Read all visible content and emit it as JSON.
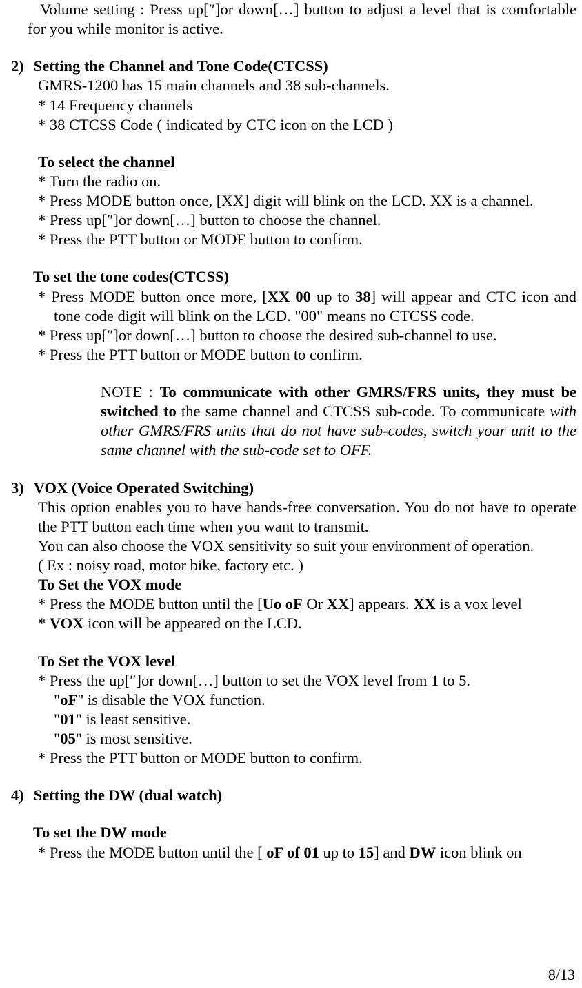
{
  "top": {
    "volume_line": "Volume setting : Press up[″]or down[…] button to adjust a level that is comfortable for you while monitor is active."
  },
  "s2": {
    "num": "2)",
    "title": "Setting the Channel and Tone Code(CTCSS)",
    "intro": "GMRS-1200 has 15 main channels and 38 sub-channels.",
    "b1": "* 14 Frequency channels",
    "b2": "* 38 CTCSS Code ( indicated by CTC icon on the LCD )",
    "sel_title": "To select the channel",
    "sel_b1": "* Turn the radio on.",
    "sel_b2": "* Press MODE button once, [XX] digit will blink on the LCD. XX is a channel.",
    "sel_b3": "* Press up[″]or down[…] button to choose the channel.",
    "sel_b4": "* Press the PTT button or MODE button to confirm.",
    "tone_title": "To set the tone codes(CTCSS)",
    "tone_b1_a": "* Press MODE button once more, [",
    "tone_b1_b": "XX 00",
    "tone_b1_c": " up to ",
    "tone_b1_d": "38",
    "tone_b1_e": "] will appear and CTC icon and tone code digit will blink on the LCD. \"00\" means no CTCSS code.",
    "tone_b2": "* Press up[″]or down[…] button to choose the desired sub-channel to use.",
    "tone_b3": "* Press the PTT button or MODE button to confirm.",
    "note_pre": "NOTE : ",
    "note_bold": "To communicate with other GMRS/FRS units, they must be switched to",
    "note_mid": " the same channel and CTCSS sub-code. To communicate ",
    "note_ital": "with other GMRS/FRS units that do not have sub-codes, switch your unit to the same channel with the sub-code set to OFF."
  },
  "s3": {
    "num": "3)",
    "title": "VOX (Voice Operated Switching)",
    "p1": "This option enables you to have hands-free conversation. You do not have to operate the PTT button each time when you want to transmit.",
    "p2": "You can also choose the VOX sensitivity so suit your environment of operation.",
    "p3": "( Ex : noisy road, motor bike, factory etc. )",
    "setmode_title": "To Set the VOX mode",
    "setmode_b1_a": "* Press the MODE button until the [",
    "setmode_b1_b": "Uo oF",
    "setmode_b1_c": " Or ",
    "setmode_b1_d": "XX",
    "setmode_b1_e": "] appears. ",
    "setmode_b1_f": "XX",
    "setmode_b1_g": " is a vox level",
    "setmode_b2_a": "* ",
    "setmode_b2_b": "VOX",
    "setmode_b2_c": " icon will be appeared on the LCD.",
    "setlevel_title": "To Set the VOX level",
    "setlevel_b1": "* Press the up[″]or down[…] button to set the VOX level from 1 to 5.",
    "setlevel_l1a": "\"",
    "setlevel_l1b": "oF",
    "setlevel_l1c": "\" is disable the VOX function.",
    "setlevel_l2a": "\"",
    "setlevel_l2b": "01",
    "setlevel_l2c": "\" is least sensitive.",
    "setlevel_l3a": "\"",
    "setlevel_l3b": "05",
    "setlevel_l3c": "\" is most sensitive.",
    "setlevel_b2": "* Press the PTT button or MODE button to confirm."
  },
  "s4": {
    "num": "4)",
    "title": "Setting the DW (dual watch)",
    "dw_title": "To set the DW mode",
    "dw_b1_a": "* Press the MODE button until the [ ",
    "dw_b1_b": "oF of 01",
    "dw_b1_c": " up to ",
    "dw_b1_d": "15",
    "dw_b1_e": "] and ",
    "dw_b1_f": "DW",
    "dw_b1_g": " icon blink on"
  },
  "page_number": "8/13"
}
